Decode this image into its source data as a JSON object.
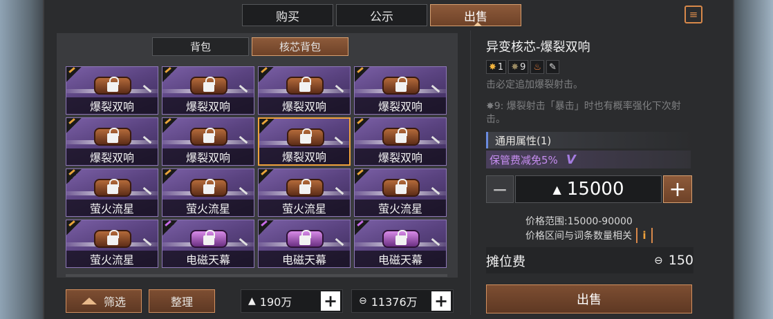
{
  "top_tabs": [
    {
      "label": "购买"
    },
    {
      "label": "公示"
    },
    {
      "label": "出售"
    }
  ],
  "sub_tabs": [
    {
      "label": "背包"
    },
    {
      "label": "核芯背包"
    }
  ],
  "grid_items": [
    {
      "name": "爆裂双响",
      "theme": "orange"
    },
    {
      "name": "爆裂双响",
      "theme": "orange"
    },
    {
      "name": "爆裂双响",
      "theme": "orange"
    },
    {
      "name": "爆裂双响",
      "theme": "orange"
    },
    {
      "name": "爆裂双响",
      "theme": "orange"
    },
    {
      "name": "爆裂双响",
      "theme": "orange"
    },
    {
      "name": "爆裂双响",
      "theme": "orange",
      "selected": true
    },
    {
      "name": "爆裂双响",
      "theme": "orange"
    },
    {
      "name": "萤火流星",
      "theme": "orange"
    },
    {
      "name": "萤火流星",
      "theme": "orange"
    },
    {
      "name": "萤火流星",
      "theme": "orange"
    },
    {
      "name": "萤火流星",
      "theme": "orange"
    },
    {
      "name": "萤火流星",
      "theme": "orange"
    },
    {
      "name": "电磁天幕",
      "theme": "purple"
    },
    {
      "name": "电磁天幕",
      "theme": "purple"
    },
    {
      "name": "电磁天幕",
      "theme": "purple"
    }
  ],
  "bottom": {
    "filter_label": "筛选",
    "sort_label": "整理",
    "currency1": "190万",
    "currency2": "11376万"
  },
  "detail": {
    "title": "异变核芯-爆裂双响",
    "badge1": "1",
    "badge2": "9",
    "desc1": "击必定追加爆裂射击。",
    "desc2": "✸9: 爆裂射击「暴击」时也有概率强化下次射击。",
    "prop_header": "通用属性(1)",
    "prop_value": "保管费减免5%"
  },
  "price": {
    "value": "15000",
    "range": "价格范围:15000-90000",
    "note": "价格区间与词条数量相关",
    "fee_label": "摊位费",
    "fee_value": "150"
  },
  "sell_label": "出售",
  "colors": {
    "accent": "#d9894a",
    "active_tab": "#7d4e32",
    "card_purple": "#5a4380",
    "prop_text": "#c68df0"
  }
}
